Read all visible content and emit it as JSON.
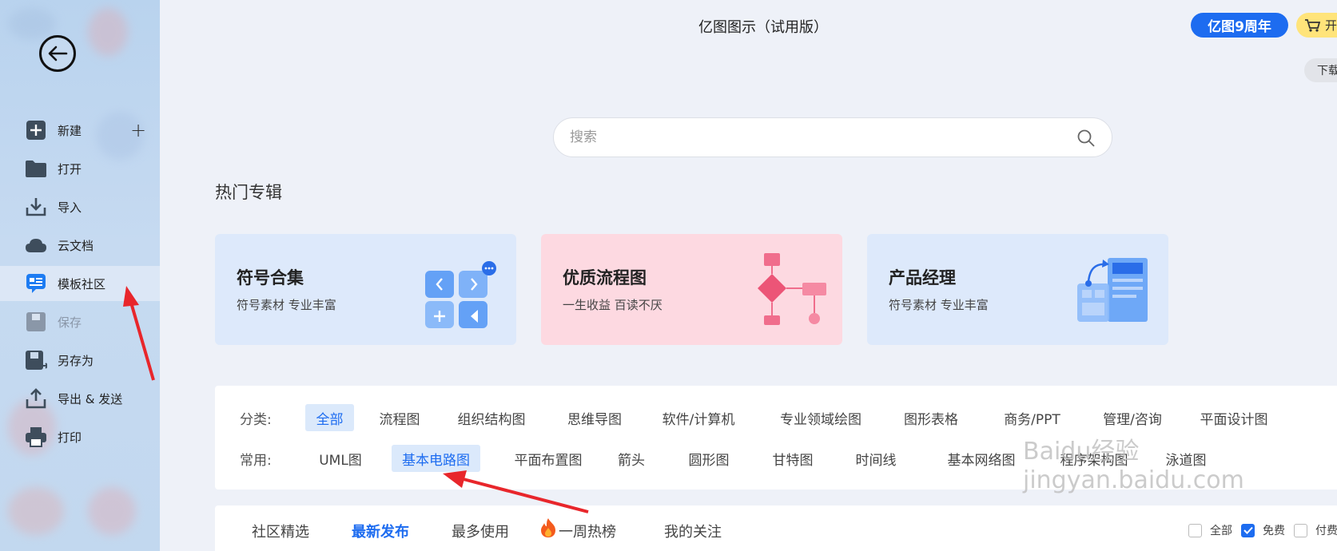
{
  "app": {
    "title": "亿图图示（试用版）"
  },
  "topbar": {
    "anniversary": "亿图9周年",
    "cart_label": "开",
    "download_label": "下载"
  },
  "sidebar": {
    "items": [
      {
        "label": "新建",
        "icon": "plus-square-icon"
      },
      {
        "label": "打开",
        "icon": "folder-icon"
      },
      {
        "label": "导入",
        "icon": "import-icon"
      },
      {
        "label": "云文档",
        "icon": "cloud-icon"
      },
      {
        "label": "模板社区",
        "icon": "template-community-icon"
      },
      {
        "label": "保存",
        "icon": "save-icon"
      },
      {
        "label": "另存为",
        "icon": "save-as-icon"
      },
      {
        "label": "导出 & 发送",
        "icon": "export-icon"
      },
      {
        "label": "打印",
        "icon": "printer-icon"
      }
    ]
  },
  "search": {
    "placeholder": "搜索"
  },
  "hot": {
    "title": "热门专辑",
    "cards": [
      {
        "title": "符号合集",
        "subtitle": "符号素材 专业丰富",
        "bg": "#dde9fb"
      },
      {
        "title": "优质流程图",
        "subtitle": "一生收益 百读不厌",
        "bg": "#fdd9e1"
      },
      {
        "title": "产品经理",
        "subtitle": "符号素材 专业丰富",
        "bg": "#dde9fb"
      }
    ]
  },
  "filters": {
    "category_label": "分类:",
    "categories": [
      "全部",
      "流程图",
      "组织结构图",
      "思维导图",
      "软件/计算机",
      "专业领域绘图",
      "图形表格",
      "商务/PPT",
      "管理/咨询",
      "平面设计图"
    ],
    "selected_category": "全部",
    "common_label": "常用:",
    "common": [
      "UML图",
      "基本电路图",
      "平面布置图",
      "箭头",
      "圆形图",
      "甘特图",
      "时间线",
      "基本网络图",
      "程序架构图",
      "泳道图"
    ],
    "selected_common": "基本电路图"
  },
  "tabs": {
    "items": [
      "社区精选",
      "最新发布",
      "最多使用",
      "一周热榜",
      "我的关注"
    ],
    "active": "最新发布"
  },
  "price_filter": {
    "options": [
      {
        "label": "全部",
        "checked": false
      },
      {
        "label": "免费",
        "checked": true
      },
      {
        "label": "付费",
        "checked": false
      }
    ]
  },
  "watermark": "Baidu经验 jingyan.baidu.com",
  "colors": {
    "accent": "#1d6cf0",
    "annotation": "#e8262b"
  }
}
